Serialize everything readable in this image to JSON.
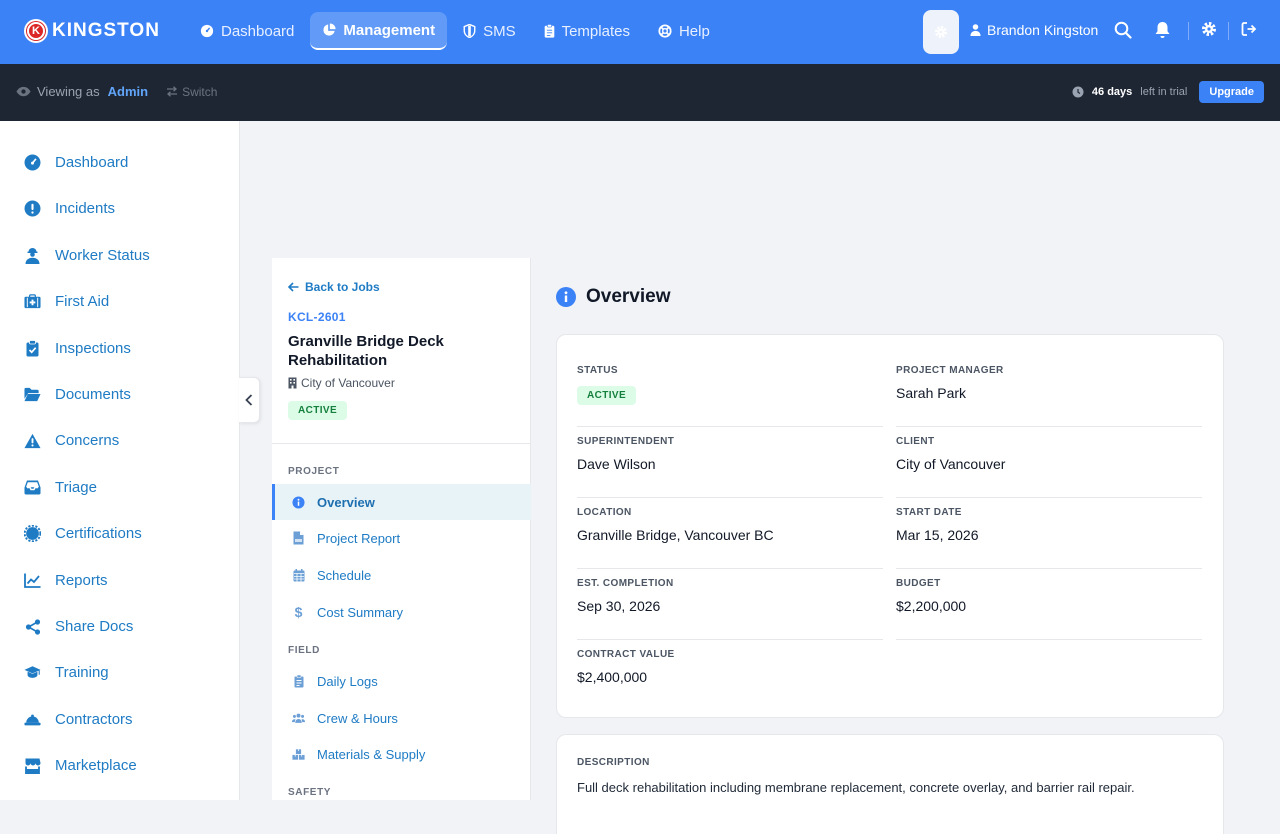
{
  "brand": {
    "name": "KINGSTON",
    "mark": "K"
  },
  "nav": {
    "items": [
      {
        "label": "Dashboard",
        "icon": "gauge-icon"
      },
      {
        "label": "Management",
        "icon": "pie-chart-icon",
        "active": true
      },
      {
        "label": "SMS",
        "icon": "shield-icon"
      },
      {
        "label": "Templates",
        "icon": "clipboard-icon"
      },
      {
        "label": "Help",
        "icon": "lifebuoy-icon"
      }
    ]
  },
  "user": {
    "name": "Brandon Kingston"
  },
  "viewing": {
    "prefix": "Viewing as",
    "role": "Admin",
    "switch_label": "Switch"
  },
  "trial": {
    "days": "46 days",
    "suffix": "left in trial",
    "upgrade_label": "Upgrade"
  },
  "sidebar": {
    "items": [
      {
        "label": "Dashboard",
        "icon": "gauge-icon"
      },
      {
        "label": "Incidents",
        "icon": "alert-circle-icon"
      },
      {
        "label": "Worker Status",
        "icon": "worker-icon"
      },
      {
        "label": "First Aid",
        "icon": "first-aid-kit-icon"
      },
      {
        "label": "Inspections",
        "icon": "clipboard-check-icon"
      },
      {
        "label": "Documents",
        "icon": "folder-open-icon"
      },
      {
        "label": "Concerns",
        "icon": "warning-triangle-icon"
      },
      {
        "label": "Triage",
        "icon": "inbox-icon"
      },
      {
        "label": "Certifications",
        "icon": "certificate-icon"
      },
      {
        "label": "Reports",
        "icon": "line-chart-icon"
      },
      {
        "label": "Share Docs",
        "icon": "share-icon"
      },
      {
        "label": "Training",
        "icon": "graduation-cap-icon"
      },
      {
        "label": "Contractors",
        "icon": "hard-hat-icon"
      },
      {
        "label": "Marketplace",
        "icon": "store-icon"
      }
    ]
  },
  "job": {
    "back_label": "Back to Jobs",
    "id": "KCL-2601",
    "title": "Granville Bridge Deck Rehabilitation",
    "client": "City of Vancouver",
    "status": "ACTIVE",
    "sections": [
      {
        "heading": "PROJECT",
        "items": [
          {
            "label": "Overview",
            "icon": "info-icon",
            "active": true
          },
          {
            "label": "Project Report",
            "icon": "pdf-file-icon"
          },
          {
            "label": "Schedule",
            "icon": "calendar-icon"
          },
          {
            "label": "Cost Summary",
            "icon": "dollar-icon"
          }
        ]
      },
      {
        "heading": "FIELD",
        "items": [
          {
            "label": "Daily Logs",
            "icon": "clipboard-list-icon"
          },
          {
            "label": "Crew & Hours",
            "icon": "users-icon"
          },
          {
            "label": "Materials & Supply",
            "icon": "boxes-icon"
          }
        ]
      },
      {
        "heading": "SAFETY",
        "items": []
      }
    ]
  },
  "overview": {
    "title": "Overview",
    "fields": [
      {
        "label": "STATUS",
        "value": "ACTIVE",
        "badge": true
      },
      {
        "label": "PROJECT MANAGER",
        "value": "Sarah Park"
      },
      {
        "label": "SUPERINTENDENT",
        "value": "Dave Wilson"
      },
      {
        "label": "CLIENT",
        "value": "City of Vancouver"
      },
      {
        "label": "LOCATION",
        "value": "Granville Bridge, Vancouver BC"
      },
      {
        "label": "START DATE",
        "value": "Mar 15, 2026"
      },
      {
        "label": "EST. COMPLETION",
        "value": "Sep 30, 2026"
      },
      {
        "label": "BUDGET",
        "value": "$2,200,000"
      },
      {
        "label": "CONTRACT VALUE",
        "value": "$2,400,000"
      }
    ],
    "description_label": "DESCRIPTION",
    "description": "Full deck rehabilitation including membrane replacement, concrete overlay, and barrier rail repair."
  },
  "colors": {
    "primary": "#3b82f6",
    "dark_bar": "#1f2633",
    "link": "#1e7bc4",
    "success_bg": "#dcfce7",
    "success_fg": "#15803d"
  }
}
